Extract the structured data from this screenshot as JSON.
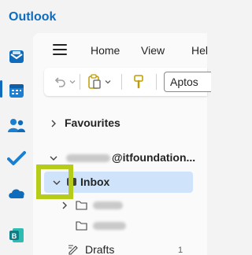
{
  "app": {
    "title": "Outlook"
  },
  "rail": {
    "items": [
      {
        "name": "mail"
      },
      {
        "name": "calendar"
      },
      {
        "name": "people"
      },
      {
        "name": "to-do"
      },
      {
        "name": "onedrive"
      },
      {
        "name": "bookings"
      }
    ]
  },
  "menubar": {
    "items": [
      {
        "label": "Home"
      },
      {
        "label": "View"
      },
      {
        "label": "Hel"
      }
    ]
  },
  "toolbar": {
    "font_value": "Aptos"
  },
  "folders": {
    "favourites": "Favourites",
    "account_suffix": "@itfoundation...",
    "inbox": "Inbox",
    "drafts": "Drafts",
    "drafts_count": "1"
  },
  "colors": {
    "brand": "#0f6cbd",
    "selection": "#cfe4fa",
    "highlight": "#b5cc18"
  }
}
